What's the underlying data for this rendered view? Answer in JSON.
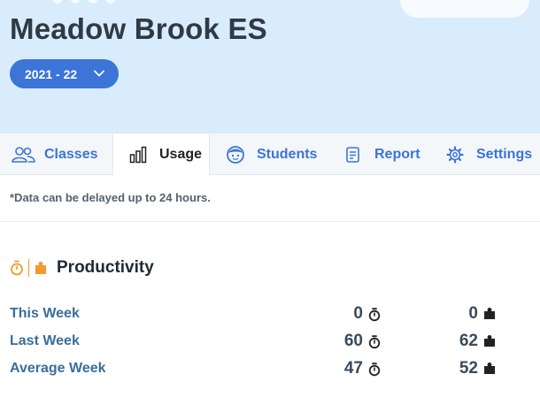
{
  "header": {
    "school_name": "Meadow Brook ES",
    "year_selector": {
      "label": "2021 - 22"
    }
  },
  "tabs": [
    {
      "label": "Classes",
      "icon": "people-icon",
      "active": false
    },
    {
      "label": "Usage",
      "icon": "bar-chart-icon",
      "active": true
    },
    {
      "label": "Students",
      "icon": "student-face-icon",
      "active": false
    },
    {
      "label": "Report",
      "icon": "report-icon",
      "active": false
    },
    {
      "label": "Settings",
      "icon": "gear-icon",
      "active": false
    }
  ],
  "note": "*Data can be delayed up to 24 hours.",
  "productivity": {
    "title": "Productivity",
    "rows": [
      {
        "label": "This Week",
        "time_value": "0",
        "puzzle_value": "0"
      },
      {
        "label": "Last Week",
        "time_value": "60",
        "puzzle_value": "62"
      },
      {
        "label": "Average Week",
        "time_value": "47",
        "puzzle_value": "52"
      }
    ]
  },
  "colors": {
    "accent": "#3c74d8",
    "hero_background": "#d9ecfb",
    "productivity_icon": "#f29b2c"
  }
}
